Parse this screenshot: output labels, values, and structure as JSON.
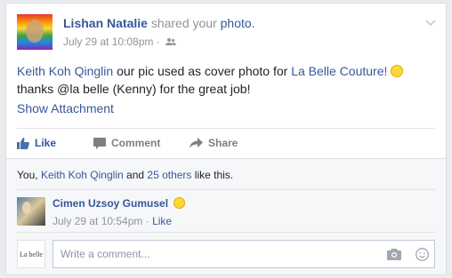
{
  "post": {
    "author": "Lishan Natalie",
    "shared_text": "shared your",
    "photo_link": "photo.",
    "timestamp": "July 29 at 10:08pm",
    "separator": "·",
    "tagged_person": "Keith Koh Qinglin",
    "text_part1": "our pic used as cover photo for",
    "page_link": "La Belle Couture!",
    "text_line2": "thanks @la belle (Kenny) for the great job!",
    "show_attachment": "Show Attachment"
  },
  "actions": {
    "like": "Like",
    "comment": "Comment",
    "share": "Share"
  },
  "likes": {
    "you": "You,",
    "person": "Keith Koh Qinglin",
    "and": "and",
    "others": "25 others",
    "suffix": "like this."
  },
  "comment": {
    "author": "Cimen Uzsoy Gumusel",
    "timestamp": "July 29 at 10:54pm",
    "separator": "·",
    "like": "Like"
  },
  "composer": {
    "avatar_text": "La belle",
    "placeholder": "Write a comment..."
  },
  "colors": {
    "link": "#365899",
    "muted": "#90949c",
    "text": "#1d2129",
    "background": "#e9ebee"
  }
}
